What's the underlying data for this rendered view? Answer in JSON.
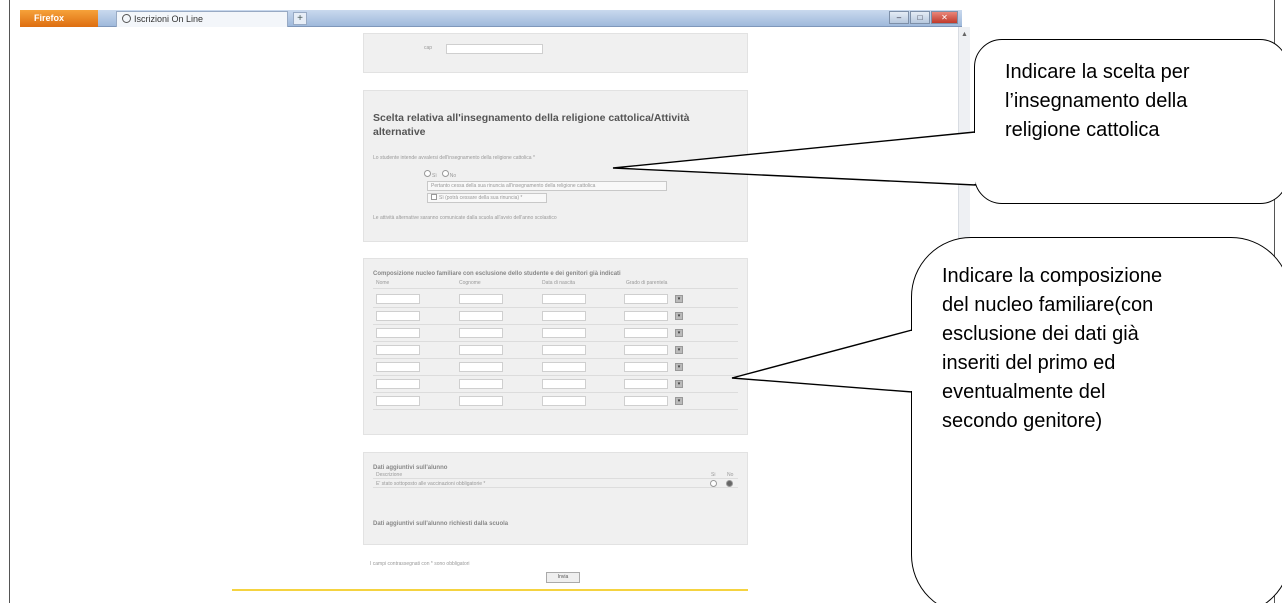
{
  "browser": {
    "app_button": "Firefox",
    "tab_title": "Iscrizioni On Line",
    "new_tab": "+",
    "window_buttons": [
      "–",
      "□",
      "✕"
    ]
  },
  "form": {
    "cap_label": "cap",
    "religion": {
      "title": "Scelta relativa all'insegnamento della religione cattolica/Attività alternative",
      "question": "Lo studente intende avvalersi dell'insegnamento della religione cattolica *",
      "option_yes": "Sì",
      "option_no": "No",
      "line1": "Pertanto cessa della sua rinuncia all'insegnamento della religione cattolica",
      "line2": "Sì (potrà cessare della sua rinuncia) *",
      "note": "Le attività alternative saranno comunicate dalla scuola all'avvio dell'anno scolastico"
    },
    "family": {
      "title": "Composizione nucleo familiare con esclusione dello studente e dei genitori già indicati",
      "columns": [
        "Nome",
        "Cognome",
        "Data di nascita",
        "Grado di parentela"
      ],
      "row_count": 7
    },
    "additional": {
      "title": "Dati aggiuntivi sull'alunno",
      "col_description": "Descrizione",
      "col_yes": "Si",
      "col_no": "No",
      "row": "E' stato sottoposto alle vaccinazioni obbligatorie *",
      "title2": "Dati aggiuntivi sull'alunno richiesti dalla scuola"
    },
    "footnote": "I campi contrassegnati con * sono obbligatori",
    "submit": "Invia"
  },
  "callouts": {
    "religion": [
      "Indicare la scelta per",
      "l’insegnamento della",
      "religione cattolica"
    ],
    "family": [
      "Indicare la composizione",
      "del nucleo familiare(con",
      "esclusione  dei dati già",
      "inseriti del primo ed",
      "eventualmente del",
      "secondo genitore)"
    ]
  }
}
